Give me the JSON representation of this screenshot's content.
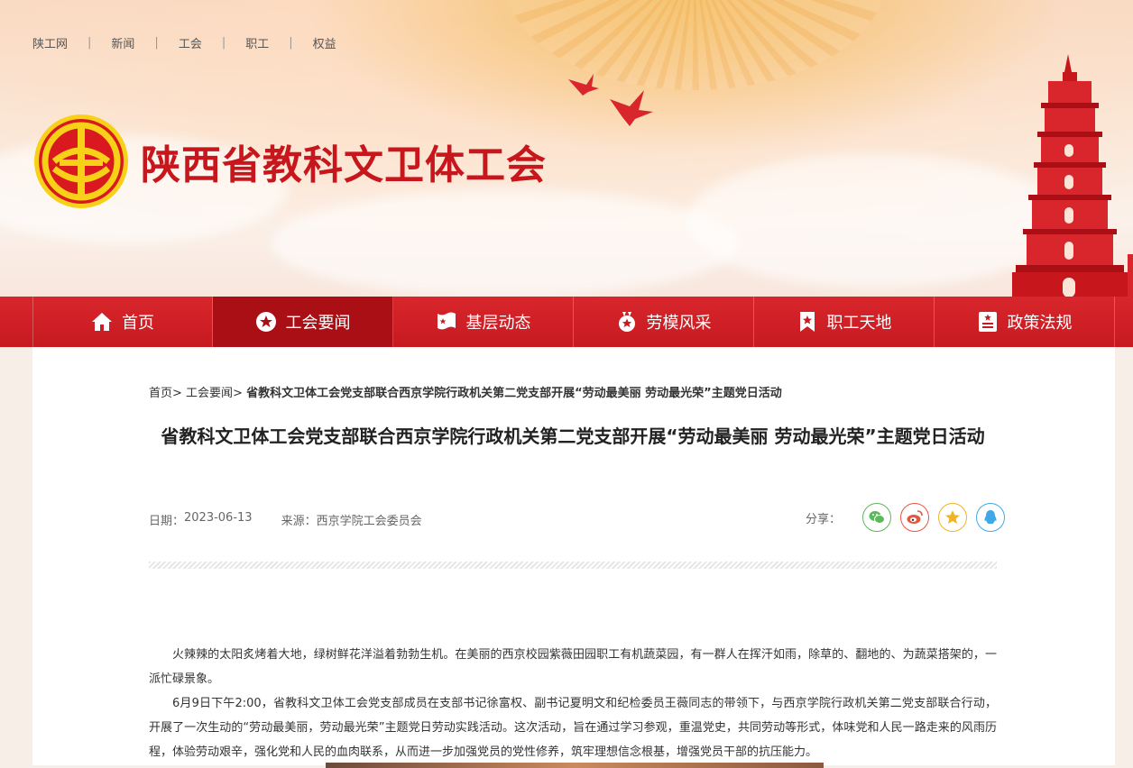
{
  "topnav": {
    "items": [
      "陕工网",
      "新闻",
      "工会",
      "职工",
      "权益"
    ]
  },
  "site": {
    "title": "陕西省教科文卫体工会",
    "brand_color": "#c8161d"
  },
  "mainnav": {
    "items": [
      {
        "label": "首页",
        "icon": "home-icon"
      },
      {
        "label": "工会要闻",
        "icon": "star-icon"
      },
      {
        "label": "基层动态",
        "icon": "flag-icon"
      },
      {
        "label": "劳模风采",
        "icon": "medal-icon"
      },
      {
        "label": "职工天地",
        "icon": "bookmark-icon"
      },
      {
        "label": "政策法规",
        "icon": "document-icon"
      }
    ],
    "active_index": 1
  },
  "breadcrumb": {
    "home": "首页>",
    "section": "工会要闻>",
    "current": "省教科文卫体工会党支部联合西京学院行政机关第二党支部开展“劳动最美丽 劳动最光荣”主题党日活动"
  },
  "article": {
    "title": "省教科文卫体工会党支部联合西京学院行政机关第二党支部开展“劳动最美丽 劳动最光荣”主题党日活动",
    "date_label": "日期：",
    "date": "2023-06-13",
    "source_label": "来源：",
    "source": "西京学院工会委员会",
    "share_label": "分享：",
    "share_icons": [
      "wechat-icon",
      "weibo-icon",
      "qzone-icon",
      "qq-icon"
    ],
    "paragraphs": [
      "火辣辣的太阳炙烤着大地，绿树鲜花洋溢着勃勃生机。在美丽的西京校园紫薇田园职工有机蔬菜园，有一群人在挥汗如雨，除草的、翻地的、为蔬菜搭架的，一派忙碌景象。",
      "6月9日下午2:00，省教科文卫体工会党支部成员在支部书记徐富权、副书记夏明文和纪检委员王薇同志的带领下，与西京学院行政机关第二党支部联合行动，开展了一次生动的“劳动最美丽，劳动最光荣”主题党日劳动实践活动。这次活动，旨在通过学习参观，重温党史，共同劳动等形式，体味党和人民一路走来的风雨历程，体验劳动艰辛，强化党和人民的血肉联系，从而进一步加强党员的党性修养，筑牢理想信念根基，增强党员干部的抗压能力。"
    ]
  }
}
